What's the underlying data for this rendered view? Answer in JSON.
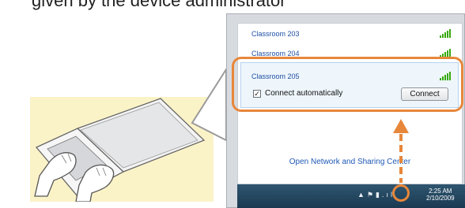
{
  "header_text": "given by the device administrator",
  "networks": [
    {
      "name": "Classroom 203"
    },
    {
      "name": "Classroom 204"
    },
    {
      "name": "Classroom 205"
    }
  ],
  "selected": {
    "checkbox_label": "Connect automatically",
    "connect_label": "Connect"
  },
  "open_network_link": "Open Network and Sharing Center",
  "taskbar": {
    "time": "2:25 AM",
    "date": "2/10/2009"
  },
  "colors": {
    "accent_orange": "#e7873a",
    "link_blue": "#1f4fa3",
    "laptop_bg": "#fbf3c8"
  },
  "icons": [
    "laptop-typing-illustration",
    "wifi-signal-icon",
    "network-tray-icon",
    "flag-icon",
    "volume-icon"
  ]
}
